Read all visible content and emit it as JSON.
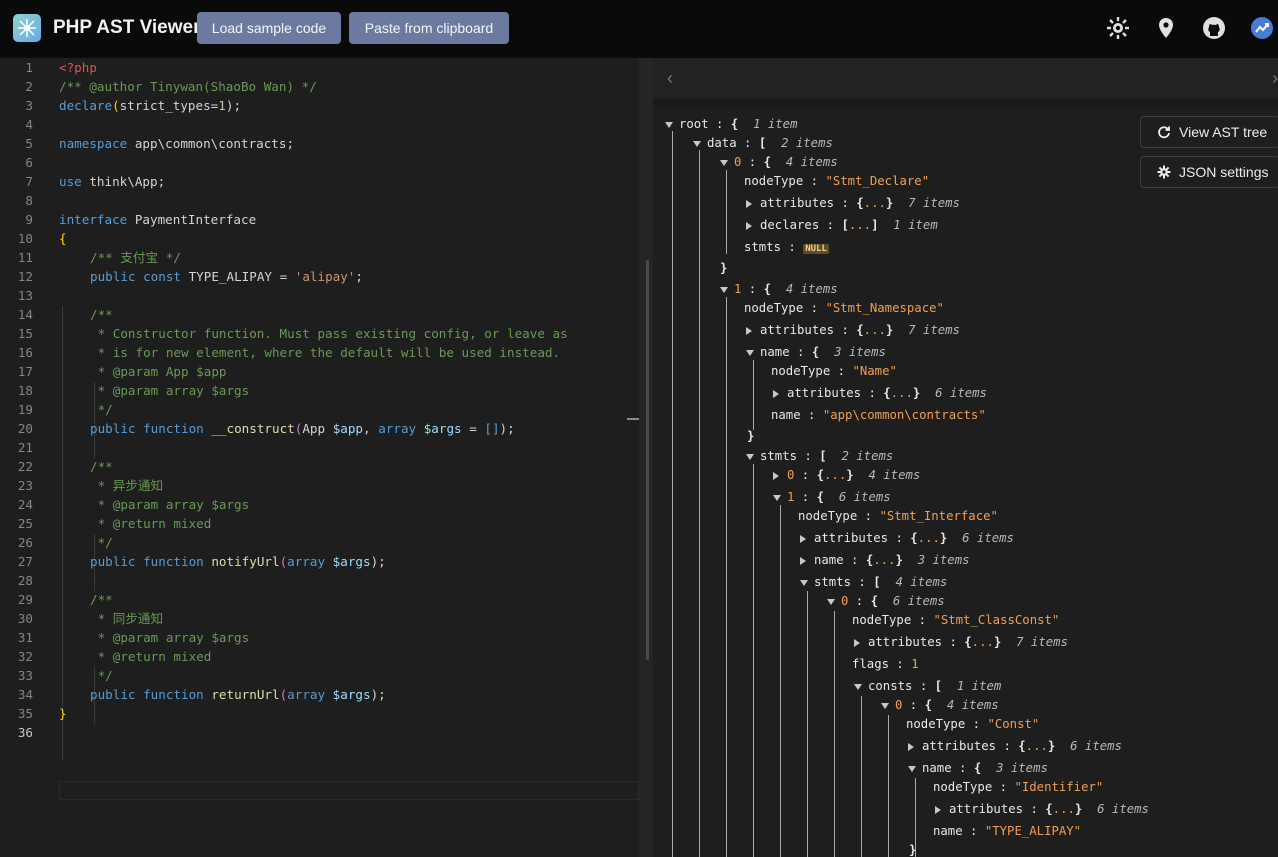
{
  "header": {
    "title": "PHP AST Viewer",
    "load_label": "Load sample code",
    "paste_label": "Paste from clipboard"
  },
  "side_buttons": {
    "view_tree_label": "View AST tree",
    "json_settings_label": "JSON settings"
  },
  "editor": {
    "lines": [
      {
        "n": "1"
      },
      {
        "n": "2"
      },
      {
        "n": "3"
      },
      {
        "n": "4"
      },
      {
        "n": "5"
      },
      {
        "n": "6"
      },
      {
        "n": "7"
      },
      {
        "n": "8"
      },
      {
        "n": "9"
      },
      {
        "n": "10"
      },
      {
        "n": "11"
      },
      {
        "n": "12"
      },
      {
        "n": "13"
      },
      {
        "n": "14"
      },
      {
        "n": "15"
      },
      {
        "n": "16"
      },
      {
        "n": "17"
      },
      {
        "n": "18"
      },
      {
        "n": "19"
      },
      {
        "n": "20"
      },
      {
        "n": "21"
      },
      {
        "n": "22"
      },
      {
        "n": "23"
      },
      {
        "n": "24"
      },
      {
        "n": "25"
      },
      {
        "n": "26"
      },
      {
        "n": "27"
      },
      {
        "n": "28"
      },
      {
        "n": "29"
      },
      {
        "n": "30"
      },
      {
        "n": "31"
      },
      {
        "n": "32"
      },
      {
        "n": "33"
      },
      {
        "n": "34"
      },
      {
        "n": "35"
      },
      {
        "n": "36"
      }
    ],
    "code": {
      "l1": "<?php",
      "l2": "/** @author Tinywan(ShaoBo Wan) */",
      "l3a": "declare",
      "l3b": "(",
      "l3c": "strict_types",
      "l3d": "=",
      "l3e": "1",
      "l3f": ");",
      "l5a": "namespace",
      "l5b": " app\\common\\contracts;",
      "l7a": "use",
      "l7b": " think\\App;",
      "l9a": "interface",
      "l9b": " PaymentInterface",
      "l10": "{",
      "l11": "/** 支付宝 */",
      "l12a": "public",
      "l12b": " const",
      "l12c": " TYPE_ALIPAY = ",
      "l12d": "'alipay'",
      "l12e": ";",
      "l14": "/**",
      "l15": " * Constructor function. Must pass existing config, or leave as",
      "l16": " * is for new element, where the default will be used instead.",
      "l17": " * @param App $app",
      "l18": " * @param array $args",
      "l19": " */",
      "l20a": "public",
      "l20b": " function",
      "l20c": " __construct",
      "l20d": "(",
      "l20e": "App ",
      "l20f": "$app",
      "l20g": ", ",
      "l20h": "array",
      "l20i": " $args",
      "l20j": " = ",
      "l20k": "[]",
      "l20l": ");",
      "l22": "/**",
      "l23": " * 异步通知",
      "l24": " * @param array $args",
      "l25": " * @return mixed",
      "l26": " */",
      "l27a": "public",
      "l27b": " function",
      "l27c": " notifyUrl",
      "l27d": "(",
      "l27e": "array",
      "l27f": " $args",
      "l27g": ");",
      "l29": "/**",
      "l30": " * 同步通知",
      "l31": " * @param array $args",
      "l32": " * @return mixed",
      "l33": " */",
      "l34a": "public",
      "l34b": " function",
      "l34c": " returnUrl",
      "l34d": "(",
      "l34e": "array",
      "l34f": " $args",
      "l34g": ");",
      "l35": "}"
    }
  },
  "tree": {
    "root_key": "root",
    "root_meta": "1 item",
    "data_key": "data",
    "data_meta": "2 items",
    "i0": "0",
    "i0_meta": "4 items",
    "nodeType_key": "nodeType",
    "declare_val": "\"Stmt_Declare\"",
    "attributes_key": "attributes",
    "attr7": "7 items",
    "attr6": "6 items",
    "declares_key": "declares",
    "declares_meta": "1 item",
    "stmts_key": "stmts",
    "null_label": "NULL",
    "i1": "1",
    "i1_meta": "4 items",
    "namespace_val": "\"Stmt_Namespace\"",
    "name_key": "name",
    "name_meta": "3 items",
    "name_val": "\"Name\"",
    "ns_name_val": "\"app\\common\\contracts\"",
    "stmts_meta": "2 items",
    "s0_meta": "4 items",
    "s1_meta": "6 items",
    "interface_val": "\"Stmt_Interface\"",
    "stmts2_meta": "4 items",
    "c0_meta": "6 items",
    "classconst_val": "\"Stmt_ClassConst\"",
    "flags_key": "flags",
    "flags_val": "1",
    "consts_key": "consts",
    "consts_meta": "1 item",
    "k0_meta": "4 items",
    "const_val": "\"Const\"",
    "identifier_val": "\"Identifier\"",
    "alipay_val": "\"TYPE_ALIPAY\"",
    "ellipsis": "..."
  },
  "icons": [
    "logo-icon",
    "gear-icon",
    "location-pin-icon",
    "github-icon",
    "trend-icon",
    "refresh-icon",
    "settings-icon",
    "chevron-left-icon"
  ]
}
